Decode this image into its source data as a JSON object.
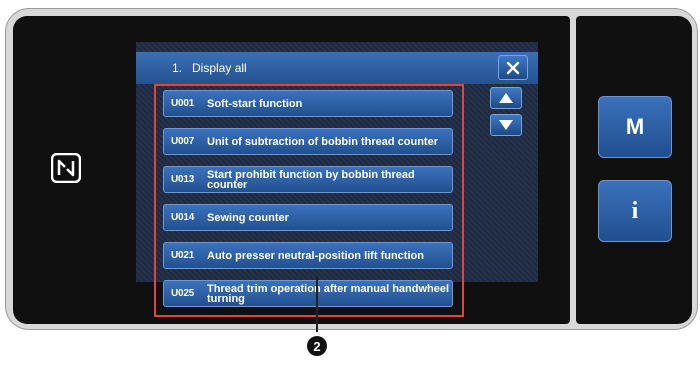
{
  "title_bar": {
    "title": "1.   Display all"
  },
  "list_items": [
    {
      "code": "U001",
      "label": "Soft-start function"
    },
    {
      "code": "U007",
      "label": "Unit of subtraction of bobbin thread counter"
    },
    {
      "code": "U013",
      "label": "Start prohibit function by bobbin thread counter"
    },
    {
      "code": "U014",
      "label": "Sewing counter"
    },
    {
      "code": "U021",
      "label": "Auto presser neutral-position lift function"
    },
    {
      "code": "U025",
      "label": "Thread trim operation after manual handwheel turning"
    }
  ],
  "side_buttons": {
    "mode_label": "M",
    "info_label": "i"
  },
  "callout": {
    "number": "2"
  },
  "icons": [
    "nfc-icon",
    "close-icon",
    "scroll-up-icon",
    "scroll-down-icon"
  ],
  "colors": {
    "screen": "#101010",
    "display_bg": "#1f2b44",
    "button_blue": "#2e62a6",
    "highlight_frame": "#e0463a"
  }
}
